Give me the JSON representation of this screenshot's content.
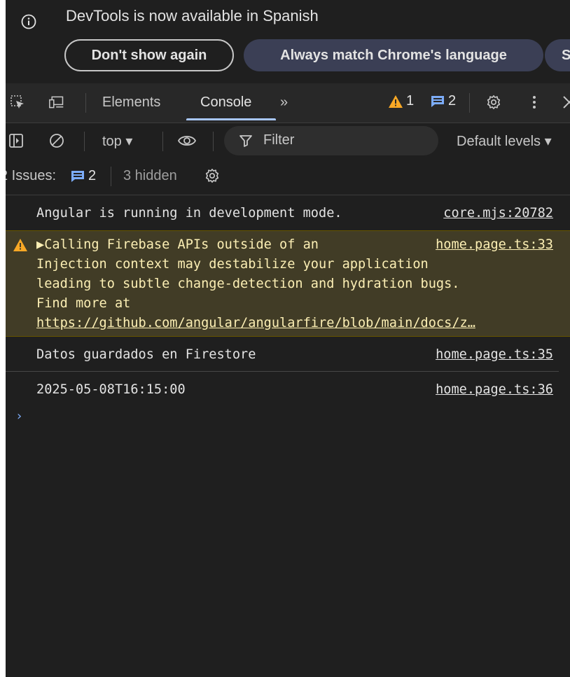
{
  "infobar": {
    "message": "DevTools is now available in Spanish",
    "dont_show_label": "Don't show again",
    "always_match_label": "Always match Chrome's language",
    "cut_label": "S"
  },
  "tabs": {
    "elements_label": "Elements",
    "console_label": "Console",
    "more_label": "»",
    "warnings_count": "1",
    "messages_count": "2"
  },
  "console_toolbar": {
    "context_label": "top ▾",
    "filter_placeholder": "Filter",
    "levels_label": "Default levels ▾"
  },
  "issues": {
    "label": "2 Issues:",
    "count": "2",
    "hidden": "3 hidden"
  },
  "messages": [
    {
      "type": "log",
      "text": "Angular is running in development mode.",
      "source": "core.mjs:20782"
    },
    {
      "type": "warning",
      "text": "▶Calling Firebase APIs outside of an\nInjection context may destabilize your application\nleading to subtle change-detection and hydration bugs.\nFind more at",
      "link": "https://github.com/angular/angularfire/blob/main/docs/z…",
      "source": "home.page.ts:33"
    },
    {
      "type": "log",
      "text": "Datos guardados en Firestore",
      "source": "home.page.ts:35"
    },
    {
      "type": "log",
      "text": "2025-05-08T16:15:00",
      "source": "home.page.ts:36"
    }
  ],
  "prompt_symbol": "›",
  "colors": {
    "background": "#1f1f1f",
    "warning_bg": "#413c26",
    "warning_text": "#fcefb4",
    "accent": "#a8c7fa",
    "warning_icon": "#f9a825"
  }
}
